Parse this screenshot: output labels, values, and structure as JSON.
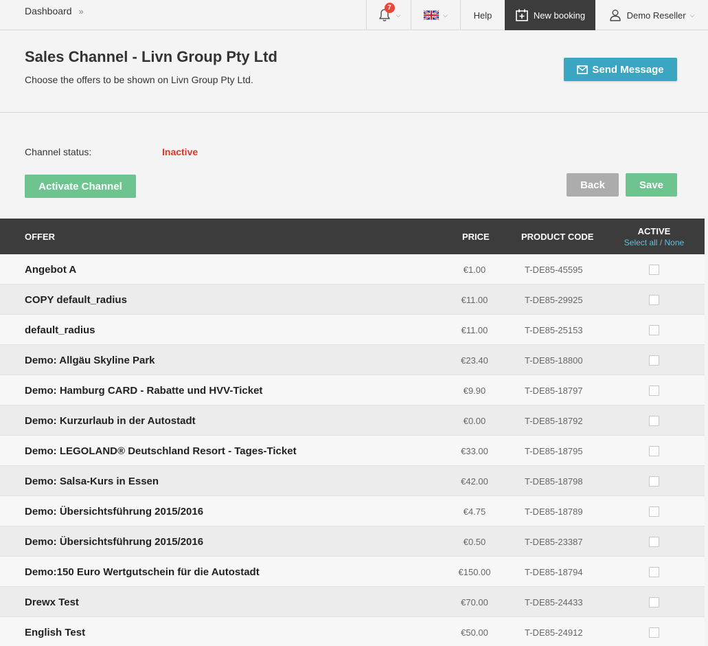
{
  "nav": {
    "breadcrumb": "Dashboard",
    "breadcrumb_sep": "»",
    "notification_count": "7",
    "help": "Help",
    "new_booking": "New booking",
    "user": "Demo Reseller"
  },
  "header": {
    "title": "Sales Channel - Livn Group Pty Ltd",
    "subtitle": "Choose the offers to be shown on Livn Group Pty Ltd.",
    "send_message": "Send Message"
  },
  "channel": {
    "status_label": "Channel status:",
    "status_value": "Inactive",
    "activate_label": "Activate Channel",
    "back_label": "Back",
    "save_label": "Save"
  },
  "table": {
    "columns": {
      "offer": "OFFER",
      "price": "PRICE",
      "code": "PRODUCT CODE",
      "active": "ACTIVE",
      "select_all": "Select all",
      "slash": "/",
      "none": "None"
    },
    "rows": [
      {
        "name": "Angebot A",
        "price": "€1.00",
        "code": "T-DE85-45595"
      },
      {
        "name": "COPY default_radius",
        "price": "€11.00",
        "code": "T-DE85-29925"
      },
      {
        "name": "default_radius",
        "price": "€11.00",
        "code": "T-DE85-25153"
      },
      {
        "name": "Demo: Allgäu Skyline Park",
        "price": "€23.40",
        "code": "T-DE85-18800"
      },
      {
        "name": "Demo: Hamburg CARD - Rabatte und HVV-Ticket",
        "price": "€9.90",
        "code": "T-DE85-18797"
      },
      {
        "name": "Demo: Kurzurlaub in der Autostadt",
        "price": "€0.00",
        "code": "T-DE85-18792"
      },
      {
        "name": "Demo: LEGOLAND® Deutschland Resort - Tages-Ticket",
        "price": "€33.00",
        "code": "T-DE85-18795"
      },
      {
        "name": "Demo: Salsa-Kurs in Essen",
        "price": "€42.00",
        "code": "T-DE85-18798"
      },
      {
        "name": "Demo: Übersichtsführung 2015/2016",
        "price": "€4.75",
        "code": "T-DE85-18789"
      },
      {
        "name": "Demo: Übersichtsführung 2015/2016",
        "price": "€0.50",
        "code": "T-DE85-23387"
      },
      {
        "name": "Demo:150 Euro Wertgutschein für die Autostadt",
        "price": "€150.00",
        "code": "T-DE85-18794"
      },
      {
        "name": "Drewx Test",
        "price": "€70.00",
        "code": "T-DE85-24433"
      },
      {
        "name": "English Test",
        "price": "€50.00",
        "code": "T-DE85-24912"
      }
    ]
  },
  "icons": {
    "bell": "bell-icon",
    "flag": "uk-flag-icon",
    "calendar": "calendar-plus-icon",
    "user": "user-icon",
    "envelope": "envelope-icon"
  },
  "colors": {
    "accent_blue": "#3aa6c1",
    "green": "#6dc48e",
    "grey_button": "#acacac",
    "dark_header": "#3c3c3c",
    "status_red": "#e5322d",
    "badge_red": "#e8473a"
  }
}
